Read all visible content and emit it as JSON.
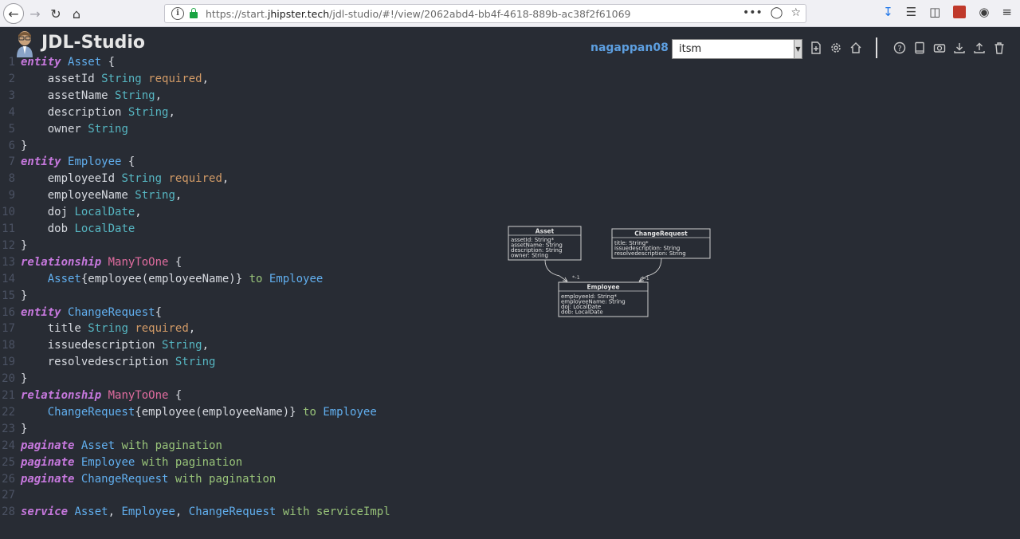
{
  "browser": {
    "url_prefix": "https://start.",
    "url_domain": "jhipster.tech",
    "url_path": "/jdl-studio/#!/view/2062abd4-bb4f-4618-889b-ac38f2f61069",
    "page_actions_label": "•••"
  },
  "app": {
    "title": "JDL-Studio",
    "username": "nagappan08",
    "selected_diagram": "itsm",
    "icons_left": [
      "new-file-icon",
      "settings-icon",
      "home-icon"
    ],
    "icons_right": [
      "help-icon",
      "book-icon",
      "camera-icon",
      "download-icon",
      "upload-icon",
      "trash-icon"
    ]
  },
  "editor": {
    "lines": [
      [
        [
          "kw",
          "entity"
        ],
        [
          "code",
          " "
        ],
        [
          "ent",
          "Asset"
        ],
        [
          "code",
          " {"
        ]
      ],
      [
        [
          "code",
          "    assetId "
        ],
        [
          "typ",
          "String"
        ],
        [
          "code",
          " "
        ],
        [
          "req",
          "required"
        ],
        [
          "code",
          ","
        ]
      ],
      [
        [
          "code",
          "    assetName "
        ],
        [
          "typ",
          "String"
        ],
        [
          "code",
          ","
        ]
      ],
      [
        [
          "code",
          "    description "
        ],
        [
          "typ",
          "String"
        ],
        [
          "code",
          ","
        ]
      ],
      [
        [
          "code",
          "    owner "
        ],
        [
          "typ",
          "String"
        ]
      ],
      [
        [
          "code",
          "}"
        ]
      ],
      [
        [
          "kw",
          "entity"
        ],
        [
          "code",
          " "
        ],
        [
          "ent",
          "Employee"
        ],
        [
          "code",
          " {"
        ]
      ],
      [
        [
          "code",
          "    employeeId "
        ],
        [
          "typ",
          "String"
        ],
        [
          "code",
          " "
        ],
        [
          "req",
          "required"
        ],
        [
          "code",
          ","
        ]
      ],
      [
        [
          "code",
          "    employeeName "
        ],
        [
          "typ",
          "String"
        ],
        [
          "code",
          ","
        ]
      ],
      [
        [
          "code",
          "    doj "
        ],
        [
          "typ",
          "LocalDate"
        ],
        [
          "code",
          ","
        ]
      ],
      [
        [
          "code",
          "    dob "
        ],
        [
          "typ",
          "LocalDate"
        ]
      ],
      [
        [
          "code",
          "}"
        ]
      ],
      [
        [
          "kw",
          "relationship"
        ],
        [
          "code",
          " "
        ],
        [
          "rel",
          "ManyToOne"
        ],
        [
          "code",
          " {"
        ]
      ],
      [
        [
          "code",
          "    "
        ],
        [
          "ent",
          "Asset"
        ],
        [
          "code",
          "{employee(employeeName)} "
        ],
        [
          "pl",
          "to"
        ],
        [
          "code",
          " "
        ],
        [
          "ent",
          "Employee"
        ]
      ],
      [
        [
          "code",
          "}"
        ]
      ],
      [
        [
          "kw",
          "entity"
        ],
        [
          "code",
          " "
        ],
        [
          "ent",
          "ChangeRequest"
        ],
        [
          "code",
          "{"
        ]
      ],
      [
        [
          "code",
          "    title "
        ],
        [
          "typ",
          "String"
        ],
        [
          "code",
          " "
        ],
        [
          "req",
          "required"
        ],
        [
          "code",
          ","
        ]
      ],
      [
        [
          "code",
          "    issuedescription "
        ],
        [
          "typ",
          "String"
        ],
        [
          "code",
          ","
        ]
      ],
      [
        [
          "code",
          "    resolvedescription "
        ],
        [
          "typ",
          "String"
        ]
      ],
      [
        [
          "code",
          "}"
        ]
      ],
      [
        [
          "kw",
          "relationship"
        ],
        [
          "code",
          " "
        ],
        [
          "rel",
          "ManyToOne"
        ],
        [
          "code",
          " {"
        ]
      ],
      [
        [
          "code",
          "    "
        ],
        [
          "ent",
          "ChangeRequest"
        ],
        [
          "code",
          "{employee(employeeName)} "
        ],
        [
          "pl",
          "to"
        ],
        [
          "code",
          " "
        ],
        [
          "ent",
          "Employee"
        ]
      ],
      [
        [
          "code",
          "}"
        ]
      ],
      [
        [
          "kw",
          "paginate"
        ],
        [
          "code",
          " "
        ],
        [
          "ent",
          "Asset"
        ],
        [
          "code",
          " "
        ],
        [
          "pl",
          "with pagination"
        ]
      ],
      [
        [
          "kw",
          "paginate"
        ],
        [
          "code",
          " "
        ],
        [
          "ent",
          "Employee"
        ],
        [
          "code",
          " "
        ],
        [
          "pl",
          "with pagination"
        ]
      ],
      [
        [
          "kw",
          "paginate"
        ],
        [
          "code",
          " "
        ],
        [
          "ent",
          "ChangeRequest"
        ],
        [
          "code",
          " "
        ],
        [
          "pl",
          "with pagination"
        ]
      ],
      [],
      [
        [
          "kw",
          "service"
        ],
        [
          "code",
          " "
        ],
        [
          "ent",
          "Asset"
        ],
        [
          "code",
          ", "
        ],
        [
          "ent",
          "Employee"
        ],
        [
          "code",
          ", "
        ],
        [
          "ent",
          "ChangeRequest"
        ],
        [
          "code",
          " "
        ],
        [
          "pl",
          "with serviceImpl"
        ]
      ]
    ]
  },
  "diagram": {
    "entities": [
      {
        "name": "Asset",
        "fields": [
          "assetId: String*",
          "assetName: String",
          "description: String",
          "owner: String"
        ]
      },
      {
        "name": "ChangeRequest",
        "fields": [
          "title: String*",
          "issuedescription: String",
          "resolvedescription: String"
        ]
      },
      {
        "name": "Employee",
        "fields": [
          "employeeId: String*",
          "employeeName: String",
          "doj: LocalDate",
          "dob: LocalDate"
        ]
      }
    ],
    "multiplicity_left": "*-1",
    "multiplicity_right": "*-1"
  }
}
